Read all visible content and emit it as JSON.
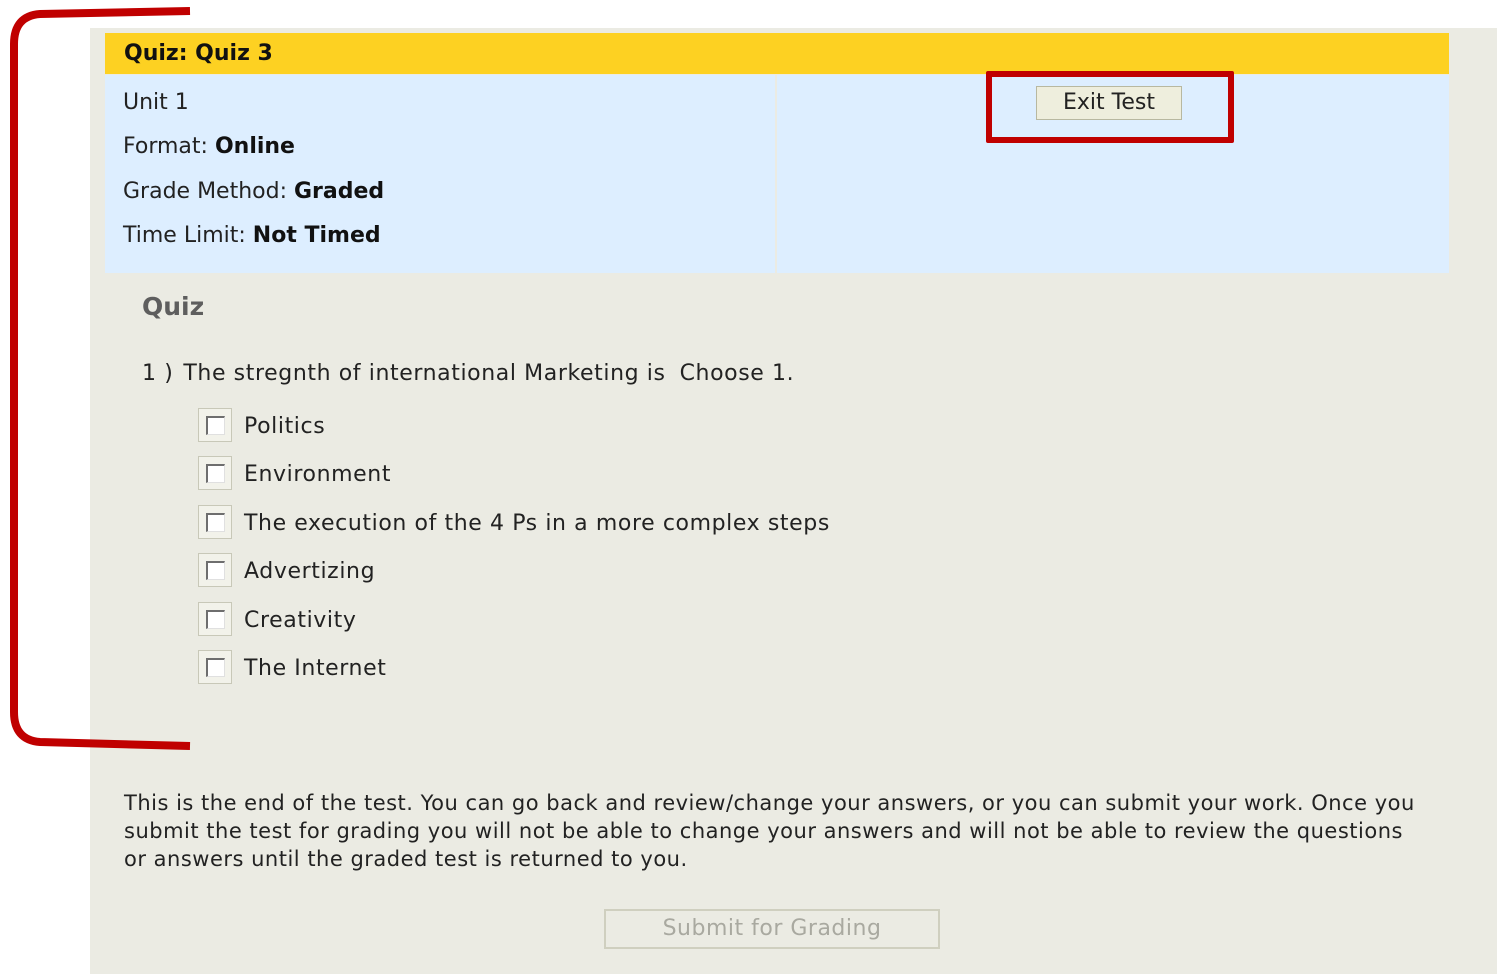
{
  "quiz": {
    "header_title": "Quiz: Quiz 3",
    "unit": "Unit 1",
    "format_label": "Format:",
    "format_value": "Online",
    "grade_method_label": "Grade Method:",
    "grade_method_value": "Graded",
    "time_limit_label": "Time Limit:",
    "time_limit_value": "Not Timed",
    "exit_button_label": "Exit Test"
  },
  "section": {
    "title": "Quiz"
  },
  "question": {
    "number": "1 )",
    "text": "The stregnth of international Marketing is",
    "hint": "Choose 1.",
    "choices": [
      {
        "label": "Politics",
        "checked": false
      },
      {
        "label": "Environment",
        "checked": false
      },
      {
        "label": "The execution of the 4 Ps in a more complex steps",
        "checked": false
      },
      {
        "label": "Advertizing",
        "checked": false
      },
      {
        "label": "Creativity",
        "checked": false
      },
      {
        "label": "The Internet",
        "checked": false
      }
    ]
  },
  "footer": {
    "end_note": "This is the end of the test. You can go back and review/change your answers, or you can submit your work. Once you submit the test for grading you will not be able to change your answers and will not be able to review the questions or answers until the graded test is returned to you.",
    "submit_button_label": "Submit for Grading",
    "submit_enabled": false
  },
  "annotations": {
    "highlight_color": "#c00000"
  },
  "colors": {
    "header_bar": "#fdd122",
    "info_panel": "#ddeeff",
    "page_background": "#ebebe3"
  }
}
